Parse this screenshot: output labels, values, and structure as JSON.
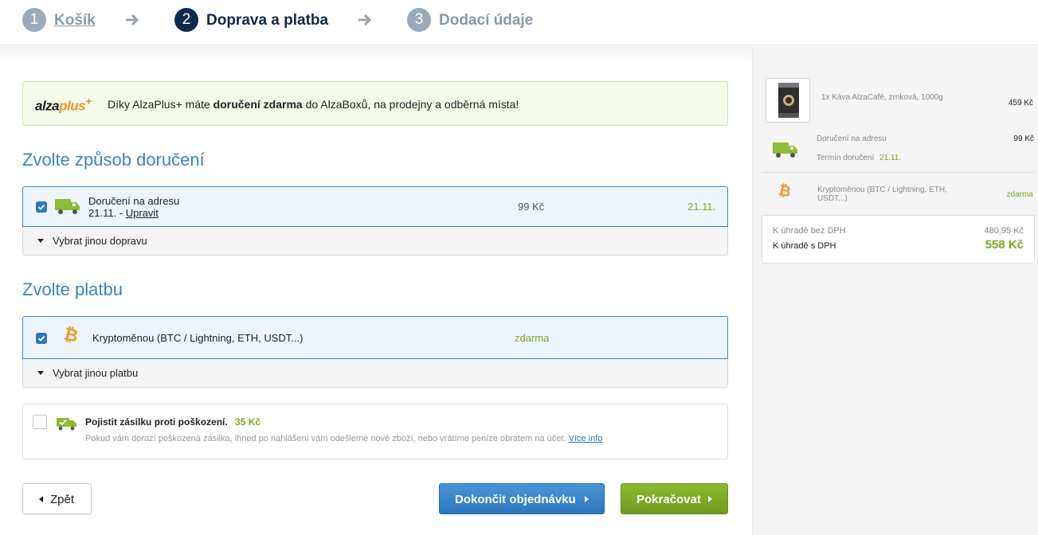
{
  "steps": [
    {
      "number": "1",
      "label": "Košík"
    },
    {
      "number": "2",
      "label": "Doprava a platba"
    },
    {
      "number": "3",
      "label": "Dodací údaje"
    }
  ],
  "alzaplus": {
    "logo_text": "alzaplus",
    "logo_plus": "+",
    "text_before": "Díky AlzaPlus+ máte ",
    "text_bold": "doručení zdarma",
    "text_after": " do AlzaBoxů, na prodejny a odběrná místa!"
  },
  "delivery": {
    "title": "Zvolte způsob doručení",
    "option_name": "Doručení na adresu",
    "option_date": "21.11. - ",
    "option_edit": "Upravit",
    "option_price": "99 Kč",
    "option_term": "21.11.",
    "more_label": "Vybrat jinou dopravu"
  },
  "payment": {
    "title": "Zvolte platbu",
    "option_name": "Kryptoměnou (BTC / Lightning, ETH, USDT...)",
    "option_price": "zdarma",
    "more_label": "Vybrat jinou platbu"
  },
  "insurance": {
    "title": "Pojistit zásilku proti poškození.",
    "price": "35 Kč",
    "description": "Pokud vám dorazí poškozená zásilka, ihned po nahlášení vám odešleme nové zboží, nebo vrátíme peníze obratem na účet.",
    "more_link": "Více info"
  },
  "buttons": {
    "back": "Zpět",
    "finish": "Dokončit objednávku",
    "continue": "Pokračovat"
  },
  "summary": {
    "product_name": "1x Káva AlzaCafé, zrnková, 1000g",
    "product_price": "459 Kč",
    "delivery_name": "Doručení na adresu",
    "delivery_price": "99 Kč",
    "delivery_term_label": "Termín doručení",
    "delivery_term_value": "21.11.",
    "payment_name": "Kryptoměnou (BTC / Lightning, ETH, USDT...)",
    "payment_price": "zdarma",
    "without_vat_label": "K úhradě bez DPH",
    "without_vat_value": "480,95 Kč",
    "with_vat_label": "K úhradě s DPH",
    "with_vat_value": "558 Kč"
  },
  "colors": {
    "accent_blue": "#3a86c4",
    "step_active": "#0c2a4d",
    "step_inactive": "#9aaab7",
    "green": "#7ea629",
    "bitcoin": "#f09a28"
  }
}
